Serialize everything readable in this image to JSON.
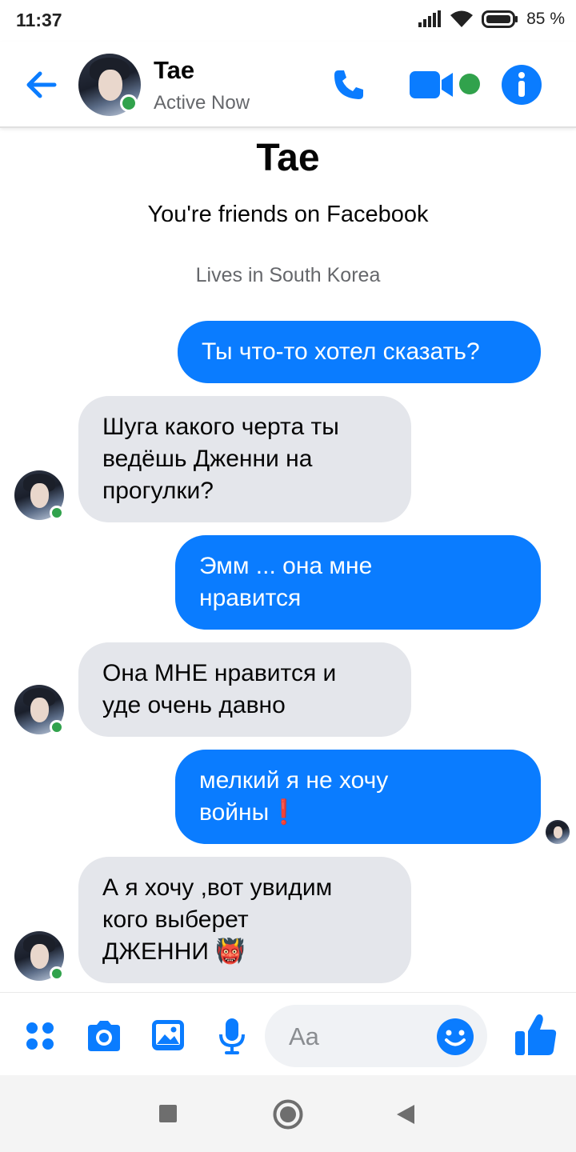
{
  "status_bar": {
    "time": "11:37",
    "battery_pct": "85 %"
  },
  "header": {
    "name": "Tae",
    "status": "Active Now"
  },
  "intro": {
    "name": "Tae",
    "friends_text": "You're friends on Facebook",
    "lives_text": "Lives in South Korea"
  },
  "messages": [
    {
      "direction": "out",
      "text": "Ты что-то хотел сказать?"
    },
    {
      "direction": "in",
      "text": "Шуга какого черта ты\nведёшь Дженни на\nпрогулки?"
    },
    {
      "direction": "out",
      "text": "Эмм ... она мне\nнравится"
    },
    {
      "direction": "in",
      "text": "Она МНЕ нравится и\nуде очень давно"
    },
    {
      "direction": "out",
      "text": "мелкий я не хочу\nвойны",
      "emoji": "❗"
    },
    {
      "direction": "in",
      "text": "А я хочу ,вот увидим\nкого выберет\nДЖЕННИ",
      "emoji": "👹"
    }
  ],
  "composer": {
    "placeholder": "Aa"
  },
  "colors": {
    "messenger_blue": "#0a7cff",
    "online_green": "#31a24c",
    "incoming_bubble": "#e4e6eb"
  },
  "icons": [
    "back-arrow-icon",
    "phone-icon",
    "video-camera-icon",
    "info-icon",
    "menu-dots-icon",
    "camera-icon",
    "gallery-icon",
    "microphone-icon",
    "emoji-smile-icon",
    "thumbs-up-icon",
    "recents-square-icon",
    "home-circle-icon",
    "back-triangle-icon"
  ]
}
